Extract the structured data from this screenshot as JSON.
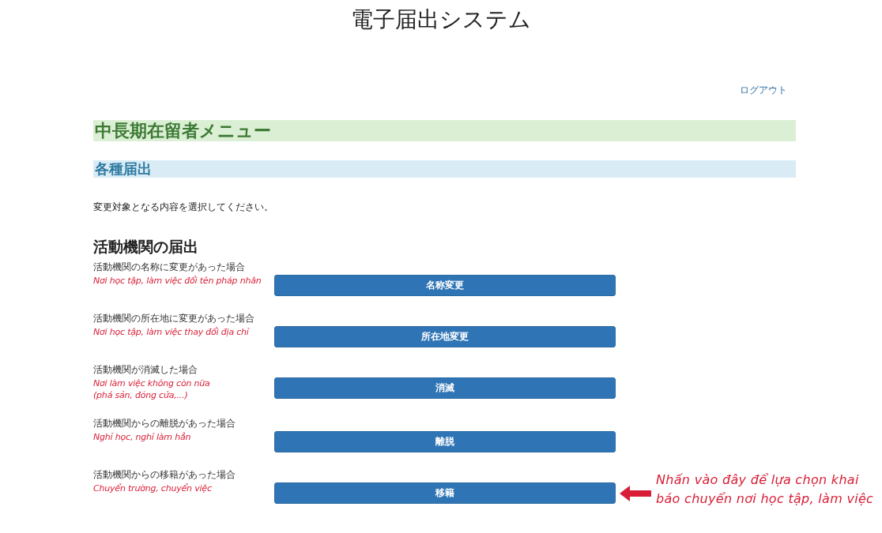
{
  "header": {
    "title": "電子届出システム",
    "logout": "ログアウト"
  },
  "menu_title": "中長期在留者メニュー",
  "section_title": "各種届出",
  "instruction": "変更対象となる内容を選択してください。",
  "group_title": "活動機関の届出",
  "items": [
    {
      "label": "活動機関の名称に変更があった場合",
      "note": "Nơi học tập, làm việc đổi tên pháp nhân",
      "button": "名称変更"
    },
    {
      "label": "活動機関の所在地に変更があった場合",
      "note": "Nơi học tập, làm việc thay đổi địa chỉ",
      "button": "所在地変更"
    },
    {
      "label": "活動機関が消滅した場合",
      "note": "Nơi làm việc không còn nữa\n(phá sản, đóng cửa,...)",
      "button": "消滅"
    },
    {
      "label": "活動機関からの離脱があった場合",
      "note": "Nghỉ học, nghỉ làm hẳn",
      "button": "離脱"
    },
    {
      "label": "活動機関からの移籍があった場合",
      "note": "Chuyển trường, chuyển việc",
      "button": "移籍",
      "annotation": "Nhấn vào đây để lựa chọn khai\nbáo chuyển nơi học tập, làm việc"
    }
  ]
}
